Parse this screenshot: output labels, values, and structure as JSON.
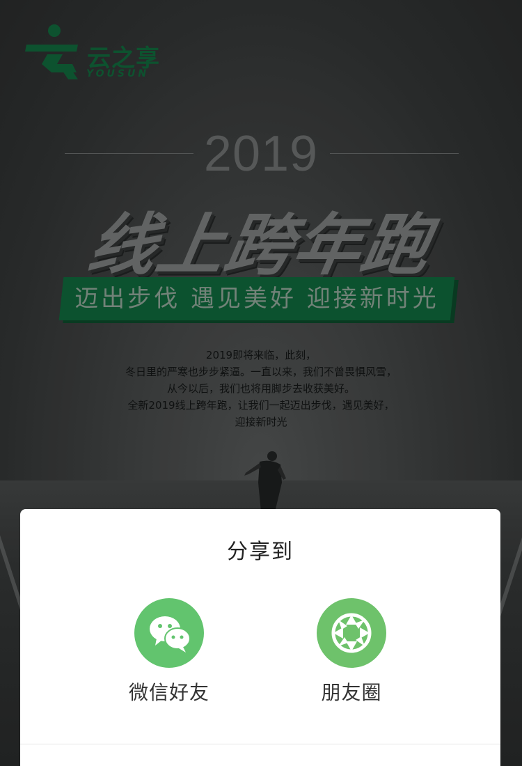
{
  "colors": {
    "brand_green": "#0f5a34",
    "banner_green": "#0e5a33",
    "wechat_green": "#62c46e",
    "moments_green": "#6ec26b",
    "sheet_bg": "#ffffff"
  },
  "logo": {
    "name": "云之享",
    "sub": "YOUSUN",
    "icon": "runner-logo-icon"
  },
  "hero": {
    "year": "2019",
    "headline": "线上跨年跑",
    "banner": "迈出步伐 遇见美好 迎接新时光"
  },
  "description": {
    "lines": [
      "2019即将来临，此刻，",
      "冬日里的严寒也步步紧逼。一直以来，我们不曾畏惧风雪，",
      "从今以后，我们也将用脚步去收获美好。",
      "全新2019线上跨年跑，让我们一起迈出步伐，遇见美好，",
      "迎接新时光"
    ]
  },
  "share_sheet": {
    "title": "分享到",
    "options": [
      {
        "label": "微信好友",
        "icon": "wechat-icon"
      },
      {
        "label": "朋友圈",
        "icon": "moments-camera-icon"
      }
    ]
  }
}
